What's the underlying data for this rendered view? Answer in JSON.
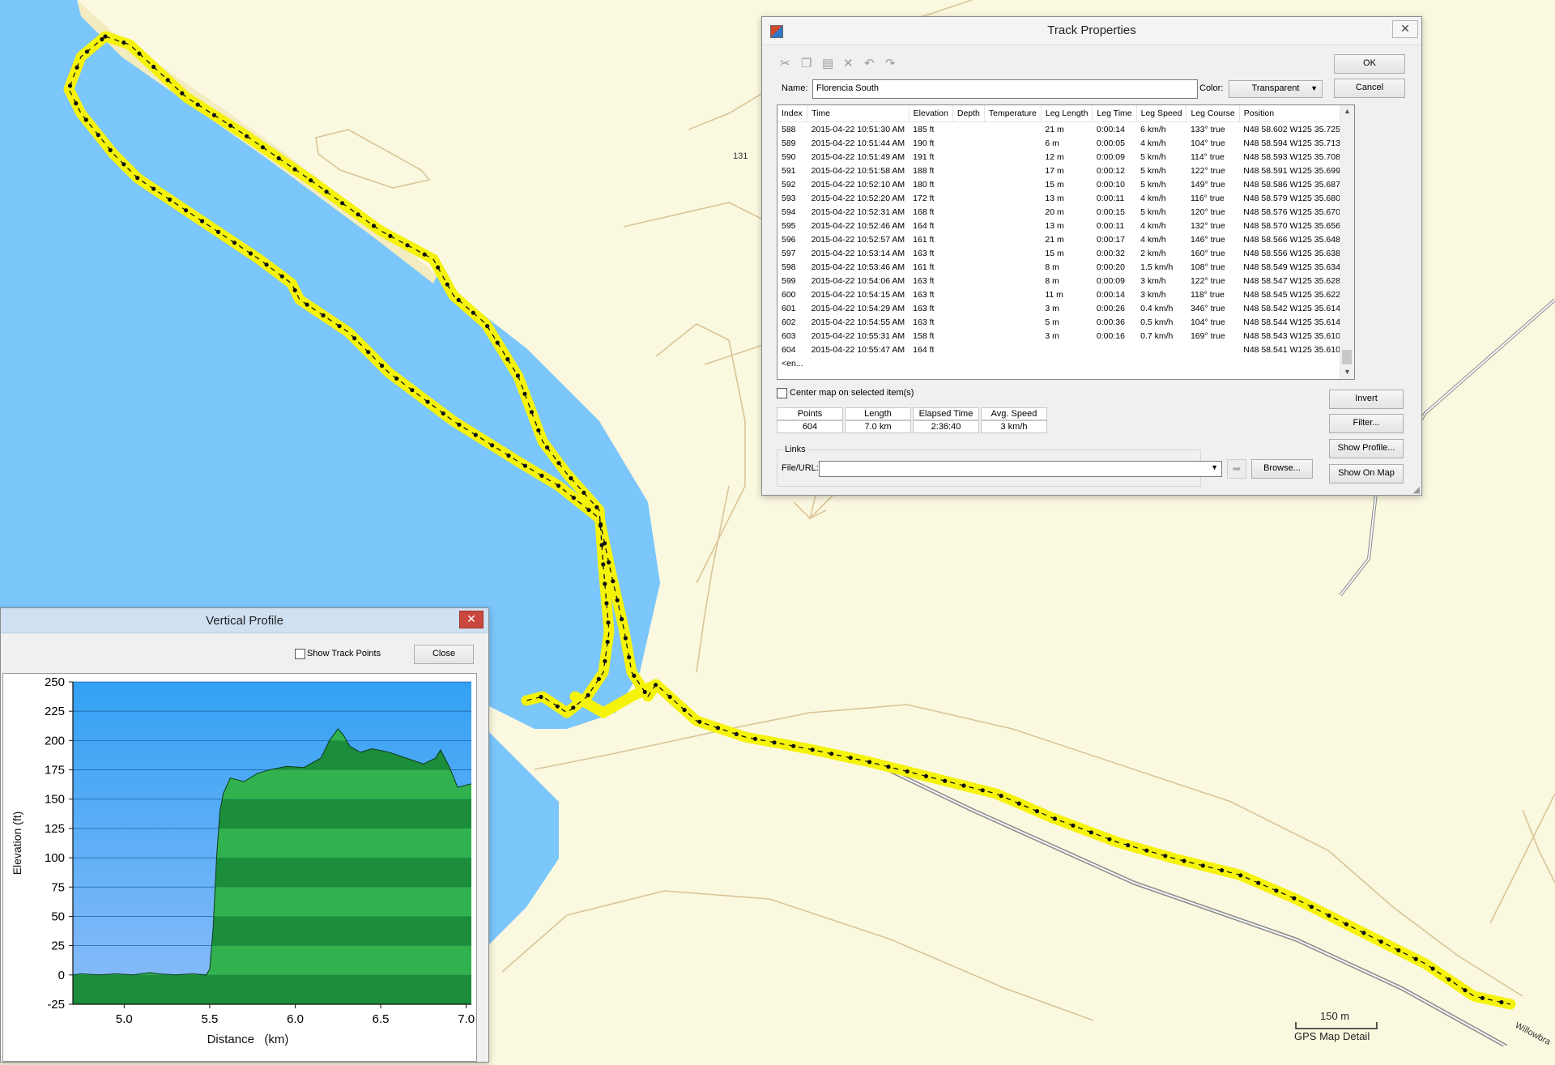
{
  "map": {
    "road_label": "131",
    "street_label": "Willowbra",
    "scale_label": "150 m",
    "detail_label": "GPS Map Detail",
    "colors": {
      "land": "#fbf8e0",
      "water": "#7bc6fb",
      "track": "#f5f30a",
      "contour": "#dcc79f"
    }
  },
  "track_properties": {
    "title": "Track Properties",
    "close_glyph": "✕",
    "ok_label": "OK",
    "cancel_label": "Cancel",
    "name_label": "Name:",
    "name_value": "Florencia South",
    "color_label": "Color:",
    "color_value": "Transparent",
    "toolbar_icons": [
      "cut-icon",
      "copy-icon",
      "paste-icon",
      "delete-icon",
      "undo-icon",
      "redo-icon"
    ],
    "columns": [
      "Index",
      "Time",
      "Elevation",
      "Depth",
      "Temperature",
      "Leg Length",
      "Leg Time",
      "Leg Speed",
      "Leg Course",
      "Position"
    ],
    "rows": [
      [
        "588",
        "2015-04-22 10:51:30 AM",
        "185 ft",
        "",
        "",
        "21 m",
        "0:00:14",
        "6 km/h",
        "133° true",
        "N48 58.602 W125 35.725"
      ],
      [
        "589",
        "2015-04-22 10:51:44 AM",
        "190 ft",
        "",
        "",
        "6 m",
        "0:00:05",
        "4 km/h",
        "104° true",
        "N48 58.594 W125 35.713"
      ],
      [
        "590",
        "2015-04-22 10:51:49 AM",
        "191 ft",
        "",
        "",
        "12 m",
        "0:00:09",
        "5 km/h",
        "114° true",
        "N48 58.593 W125 35.708"
      ],
      [
        "591",
        "2015-04-22 10:51:58 AM",
        "188 ft",
        "",
        "",
        "17 m",
        "0:00:12",
        "5 km/h",
        "122° true",
        "N48 58.591 W125 35.699"
      ],
      [
        "592",
        "2015-04-22 10:52:10 AM",
        "180 ft",
        "",
        "",
        "15 m",
        "0:00:10",
        "5 km/h",
        "149° true",
        "N48 58.586 W125 35.687"
      ],
      [
        "593",
        "2015-04-22 10:52:20 AM",
        "172 ft",
        "",
        "",
        "13 m",
        "0:00:11",
        "4 km/h",
        "116° true",
        "N48 58.579 W125 35.680"
      ],
      [
        "594",
        "2015-04-22 10:52:31 AM",
        "168 ft",
        "",
        "",
        "20 m",
        "0:00:15",
        "5 km/h",
        "120° true",
        "N48 58.576 W125 35.670"
      ],
      [
        "595",
        "2015-04-22 10:52:46 AM",
        "164 ft",
        "",
        "",
        "13 m",
        "0:00:11",
        "4 km/h",
        "132° true",
        "N48 58.570 W125 35.656"
      ],
      [
        "596",
        "2015-04-22 10:52:57 AM",
        "161 ft",
        "",
        "",
        "21 m",
        "0:00:17",
        "4 km/h",
        "146° true",
        "N48 58.566 W125 35.648"
      ],
      [
        "597",
        "2015-04-22 10:53:14 AM",
        "163 ft",
        "",
        "",
        "15 m",
        "0:00:32",
        "2 km/h",
        "160° true",
        "N48 58.556 W125 35.638"
      ],
      [
        "598",
        "2015-04-22 10:53:46 AM",
        "161 ft",
        "",
        "",
        "8 m",
        "0:00:20",
        "1.5 km/h",
        "108° true",
        "N48 58.549 W125 35.634"
      ],
      [
        "599",
        "2015-04-22 10:54:06 AM",
        "163 ft",
        "",
        "",
        "8 m",
        "0:00:09",
        "3 km/h",
        "122° true",
        "N48 58.547 W125 35.628"
      ],
      [
        "600",
        "2015-04-22 10:54:15 AM",
        "163 ft",
        "",
        "",
        "11 m",
        "0:00:14",
        "3 km/h",
        "118° true",
        "N48 58.545 W125 35.622"
      ],
      [
        "601",
        "2015-04-22 10:54:29 AM",
        "163 ft",
        "",
        "",
        "3 m",
        "0:00:26",
        "0.4 km/h",
        "346° true",
        "N48 58.542 W125 35.614"
      ],
      [
        "602",
        "2015-04-22 10:54:55 AM",
        "163 ft",
        "",
        "",
        "5 m",
        "0:00:36",
        "0.5 km/h",
        "104° true",
        "N48 58.544 W125 35.614"
      ],
      [
        "603",
        "2015-04-22 10:55:31 AM",
        "158 ft",
        "",
        "",
        "3 m",
        "0:00:16",
        "0.7 km/h",
        "169° true",
        "N48 58.543 W125 35.610"
      ],
      [
        "604",
        "2015-04-22 10:55:47 AM",
        "164 ft",
        "",
        "",
        "",
        "",
        "",
        "",
        "N48 58.541 W125 35.610"
      ]
    ],
    "end_row": "<en...",
    "center_checkbox_label": "Center map on selected item(s)",
    "stats": {
      "headers": [
        "Points",
        "Length",
        "Elapsed Time",
        "Avg. Speed"
      ],
      "values": [
        "604",
        "7.0 km",
        "2:36:40",
        "3 km/h"
      ]
    },
    "invert_label": "Invert",
    "filter_label": "Filter...",
    "show_profile_label": "Show Profile...",
    "show_on_map_label": "Show On Map",
    "links_label": "Links",
    "file_url_label": "File/URL:",
    "browse_label": "Browse..."
  },
  "vertical_profile": {
    "title": "Vertical Profile",
    "close_glyph": "✕",
    "show_track_points_label": "Show Track Points",
    "close_label": "Close"
  },
  "chart_data": {
    "type": "area",
    "title": "",
    "xlabel": "Distance   (km)",
    "ylabel": "Elevation (ft)",
    "xlim": [
      4.7,
      7.03
    ],
    "ylim": [
      -25,
      250
    ],
    "xticks": [
      "5.0",
      "5.5",
      "6.0",
      "6.5",
      "7.0"
    ],
    "yticks": [
      "250",
      "225",
      "200",
      "175",
      "150",
      "125",
      "100",
      "75",
      "50",
      "25",
      "0",
      "-25"
    ],
    "series": [
      {
        "x": [
          4.7,
          4.75,
          4.85,
          4.95,
          5.05,
          5.15,
          5.2,
          5.3,
          5.4,
          5.48,
          5.5,
          5.52,
          5.54,
          5.56,
          5.58,
          5.62,
          5.7,
          5.78,
          5.85,
          5.95,
          6.05,
          6.15,
          6.2,
          6.25,
          6.28,
          6.32,
          6.38,
          6.45,
          6.55,
          6.65,
          6.75,
          6.82,
          6.85,
          6.9,
          6.95,
          7.0,
          7.03
        ],
        "y": [
          0,
          1,
          0,
          1,
          0,
          2,
          1,
          0,
          1,
          0,
          5,
          40,
          100,
          140,
          155,
          168,
          165,
          172,
          175,
          178,
          177,
          185,
          200,
          210,
          205,
          195,
          190,
          193,
          190,
          185,
          180,
          185,
          192,
          178,
          160,
          162,
          163
        ]
      }
    ],
    "background_colors": [
      "#3aa2f0",
      "#86b9f8"
    ],
    "fill_colors": [
      "#1b8d3b",
      "#32b24f"
    ]
  }
}
